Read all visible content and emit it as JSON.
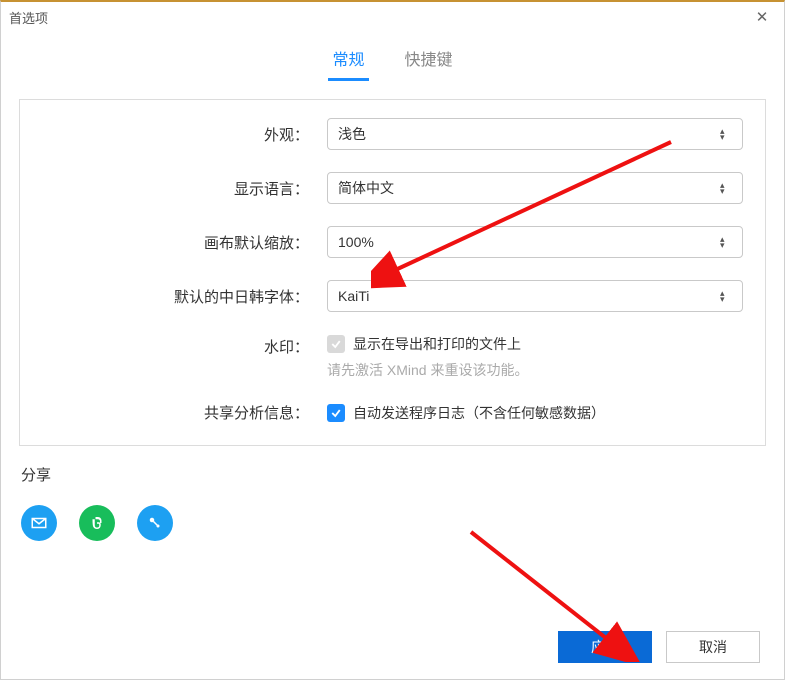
{
  "window": {
    "title": "首选项"
  },
  "tabs": {
    "general": "常规",
    "shortcuts": "快捷键"
  },
  "form": {
    "appearance": {
      "label": "外观：",
      "value": "浅色"
    },
    "language": {
      "label": "显示语言：",
      "value": "简体中文"
    },
    "zoom": {
      "label": "画布默认缩放：",
      "value": "100%"
    },
    "cjkfont": {
      "label": "默认的中日韩字体：",
      "value": "KaiTi"
    },
    "watermark": {
      "label": "水印：",
      "text": "显示在导出和打印的文件上",
      "help": "请先激活 XMind 来重设该功能。"
    },
    "analytics": {
      "label": "共享分析信息：",
      "text": "自动发送程序日志（不含任何敏感数据）"
    }
  },
  "share": {
    "title": "分享"
  },
  "footer": {
    "apply": "应用",
    "cancel": "取消"
  }
}
